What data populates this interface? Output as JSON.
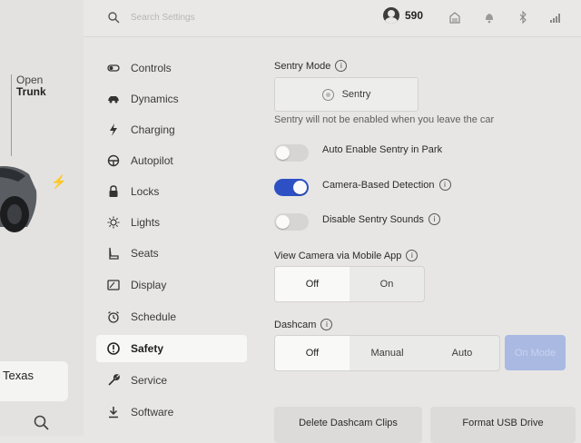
{
  "car_panel": {
    "trunk_label_1": "Open",
    "trunk_label_2": "Trunk",
    "location": "Texas"
  },
  "topbar": {
    "search_placeholder": "Search Settings",
    "range": "590"
  },
  "nav": {
    "items": [
      {
        "label": "Controls",
        "icon": "toggle-icon"
      },
      {
        "label": "Dynamics",
        "icon": "car-icon"
      },
      {
        "label": "Charging",
        "icon": "bolt-icon"
      },
      {
        "label": "Autopilot",
        "icon": "steering-wheel-icon"
      },
      {
        "label": "Locks",
        "icon": "lock-icon"
      },
      {
        "label": "Lights",
        "icon": "light-icon"
      },
      {
        "label": "Seats",
        "icon": "seat-icon"
      },
      {
        "label": "Display",
        "icon": "display-icon"
      },
      {
        "label": "Schedule",
        "icon": "alarm-icon"
      },
      {
        "label": "Safety",
        "icon": "alert-icon"
      },
      {
        "label": "Service",
        "icon": "wrench-icon"
      },
      {
        "label": "Software",
        "icon": "download-icon"
      }
    ],
    "active": "Safety"
  },
  "sentry": {
    "title": "Sentry Mode",
    "button_label": "Sentry",
    "note": "Sentry will not be enabled when you leave the car"
  },
  "toggles": {
    "auto_enable": {
      "label": "Auto Enable Sentry in Park",
      "on": false
    },
    "camera_detection": {
      "label": "Camera-Based Detection",
      "on": true
    },
    "disable_sounds": {
      "label": "Disable Sentry Sounds",
      "on": false
    }
  },
  "mobile_camera": {
    "title": "View Camera via Mobile App",
    "options": [
      "Off",
      "On"
    ],
    "selected": "Off"
  },
  "dashcam": {
    "title": "Dashcam",
    "options": [
      "Off",
      "Manual",
      "Auto"
    ],
    "selected": "Off",
    "on_demand_label": "On Mode"
  },
  "actions": {
    "delete_clips": "Delete Dashcam Clips",
    "format_usb": "Format USB Drive"
  },
  "colors": {
    "accent": "#2d51c4",
    "background": "#e7e6e4"
  }
}
